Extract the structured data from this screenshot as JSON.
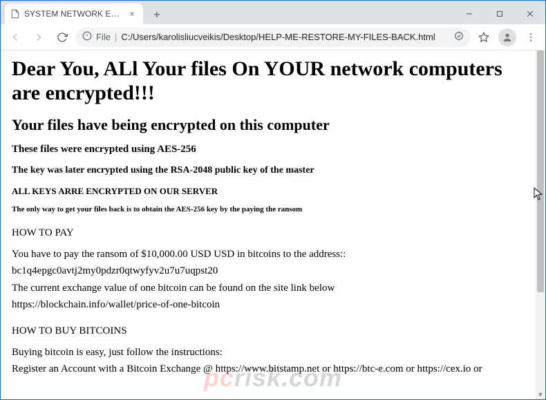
{
  "window": {
    "title": "SYSTEM NETWORK ENCRYPTED"
  },
  "tab": {
    "title": "SYSTEM NETWORK ENCRYPTED"
  },
  "address": {
    "scheme_label": "File",
    "path": "C:/Users/karolisliucveikis/Desktop/HELP-ME-RESTORE-MY-FILES-BACK.html"
  },
  "page": {
    "h1": "Dear You, ALl Your files On YOUR network computers are encrypted!!!",
    "h2": "Your files have being encrypted on this computer",
    "h3": "These files were encrypted using AES-256",
    "h4": "The key was later encrypted using the RSA-2048 public key of the master",
    "h5": "ALL KEYS ARRE ENCRYPTED ON OUR SERVER",
    "h6": "The only way to get your files back is to obtain the AES-256 key by the paying the ransom",
    "how_to_pay_heading": "HOW TO PAY",
    "pay_line1": "You have to pay the ransom of $10,000.00 USD USD in bitcoins to the address::",
    "pay_address": "bc1q4epgc0avtj2my0pdzr0qtwyfyv2u7u7uqpst20",
    "pay_line2": "The current exchange value of one bitcoin can be found on the site link below",
    "pay_link": "https://blockchain.info/wallet/price-of-one-bitcoin",
    "how_to_buy_heading": "HOW TO BUY BITCOINS",
    "buy_line1": "Buying bitcoin is easy, just follow the instructions:",
    "buy_line2": "Register an Account with a Bitcoin Exchange @ https://www.bitstamp.net or https://btc-e.com or https://cex.io or"
  },
  "watermark": {
    "brand_a": "pc",
    "brand_b": "risk",
    "suffix": ".com"
  }
}
